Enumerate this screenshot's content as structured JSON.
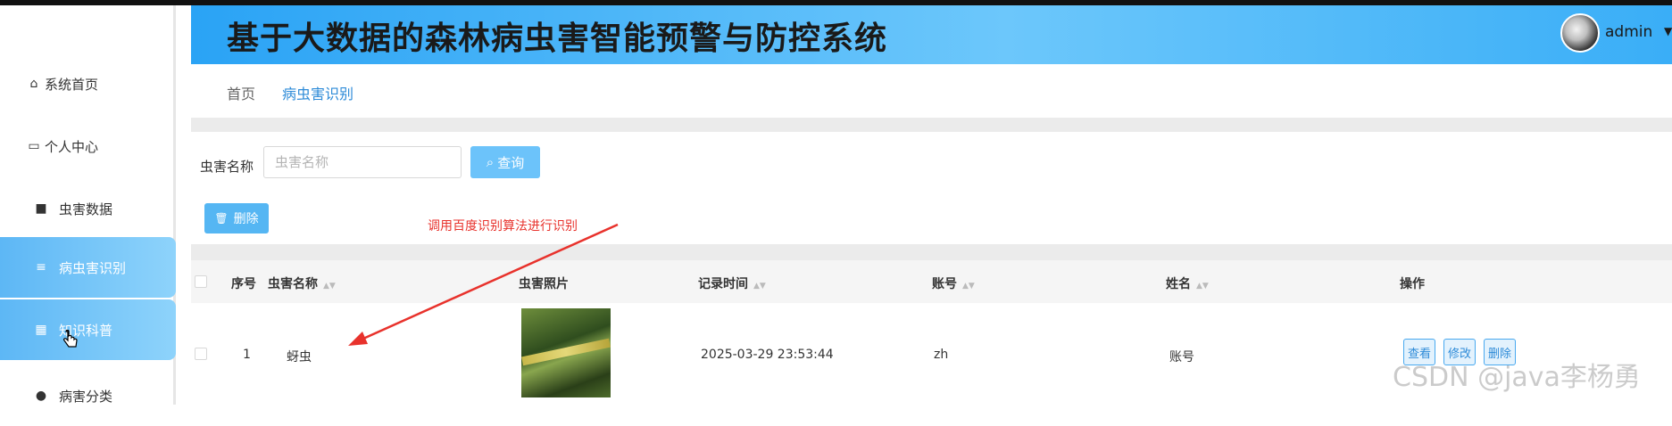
{
  "header": {
    "title": "基于大数据的森林病虫害智能预警与防控系统",
    "user": "admin"
  },
  "sidebar": {
    "items": [
      {
        "label": "系统首页",
        "icon": "home-icon"
      },
      {
        "label": "个人中心",
        "icon": "card-icon"
      },
      {
        "label": "虫害数据",
        "icon": "monitor-icon"
      },
      {
        "label": "病虫害识别",
        "icon": "list-icon"
      },
      {
        "label": "知识科普",
        "icon": "grid-icon"
      },
      {
        "label": "病害分类",
        "icon": "pin-icon"
      }
    ]
  },
  "breadcrumb": {
    "home": "首页",
    "current": "病虫害识别"
  },
  "search": {
    "label": "虫害名称",
    "placeholder": "虫害名称",
    "button": "查询"
  },
  "actions": {
    "delete": "删除"
  },
  "annotation": "调用百度识别算法进行识别",
  "table": {
    "columns": [
      "序号",
      "虫害名称",
      "虫害照片",
      "记录时间",
      "账号",
      "姓名",
      "操作"
    ],
    "rows": [
      {
        "index": "1",
        "name": "蚜虫",
        "time": "2025-03-29 23:53:44",
        "account": "zh",
        "realname": "账号",
        "ops": [
          "查看",
          "修改",
          "删除"
        ]
      }
    ]
  },
  "watermark": "CSDN @java李杨勇",
  "colors": {
    "accent": "#2e8bd8",
    "header_gradient_start": "#2aa3f5",
    "active_menu": "#5db7f5",
    "annotation": "#e8322c"
  }
}
